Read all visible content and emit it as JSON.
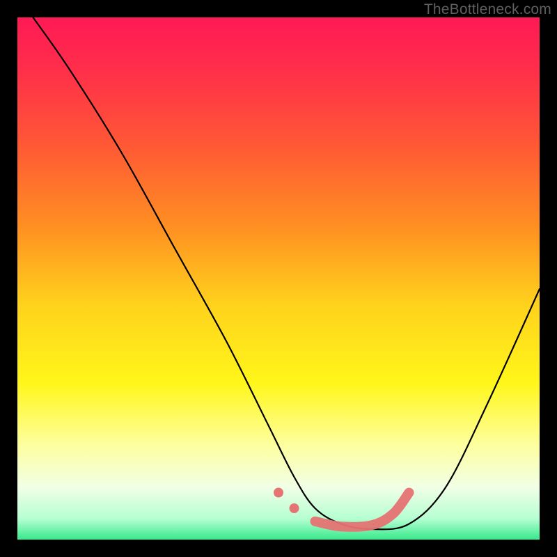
{
  "watermark": "TheBottleneck.com",
  "chart_data": {
    "type": "line",
    "title": "",
    "xlabel": "",
    "ylabel": "",
    "xlim": [
      0,
      100
    ],
    "ylim": [
      0,
      100
    ],
    "gradient_stops": [
      {
        "offset": 0.0,
        "color": "#ff1a55"
      },
      {
        "offset": 0.1,
        "color": "#ff2e4a"
      },
      {
        "offset": 0.25,
        "color": "#ff5a34"
      },
      {
        "offset": 0.4,
        "color": "#ff8f22"
      },
      {
        "offset": 0.55,
        "color": "#ffd21c"
      },
      {
        "offset": 0.7,
        "color": "#fff61a"
      },
      {
        "offset": 0.82,
        "color": "#fdffa0"
      },
      {
        "offset": 0.9,
        "color": "#f1ffe6"
      },
      {
        "offset": 0.96,
        "color": "#b5ffd1"
      },
      {
        "offset": 1.0,
        "color": "#37e98c"
      }
    ],
    "series": [
      {
        "name": "bottleneck-curve",
        "x": [
          3,
          10,
          20,
          30,
          40,
          48,
          53,
          57,
          62,
          68,
          75,
          82,
          90,
          100
        ],
        "y": [
          100,
          90,
          74,
          56,
          38,
          22,
          12,
          6,
          3,
          2,
          3,
          10,
          26,
          48
        ]
      }
    ],
    "highlight": {
      "name": "optimal-range",
      "color": "#e57373",
      "x": [
        50,
        53,
        57,
        62,
        68,
        72,
        75
      ],
      "y": [
        9,
        6,
        3.5,
        2.5,
        2.8,
        5,
        9
      ]
    }
  }
}
